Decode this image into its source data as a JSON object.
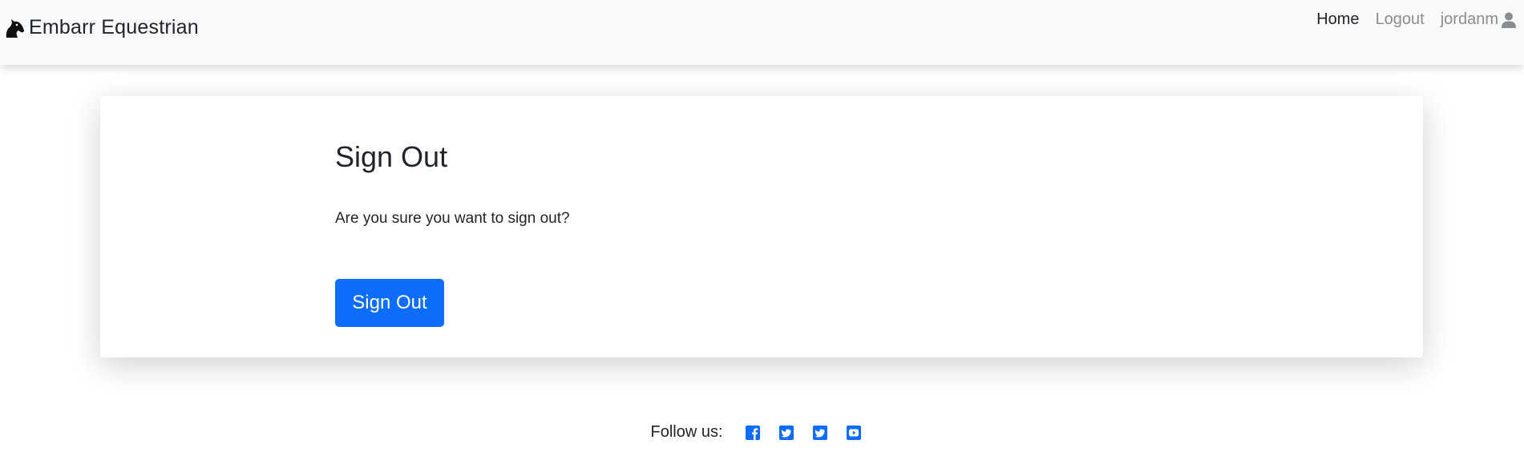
{
  "brand": {
    "name": "Embarr Equestrian",
    "icon": "horse-head-icon"
  },
  "nav": {
    "home": "Home",
    "logout": "Logout",
    "username": "jordanm",
    "user_icon": "user-icon"
  },
  "card": {
    "title": "Sign Out",
    "text": "Are you sure you want to sign out?",
    "button": "Sign Out"
  },
  "footer": {
    "follow_label": "Follow us:",
    "socials": [
      "facebook-icon",
      "twitter-icon",
      "twitter-icon",
      "youtube-icon"
    ]
  },
  "colors": {
    "accent": "#0d6efd",
    "navbar_bg": "#f8f9fa"
  }
}
